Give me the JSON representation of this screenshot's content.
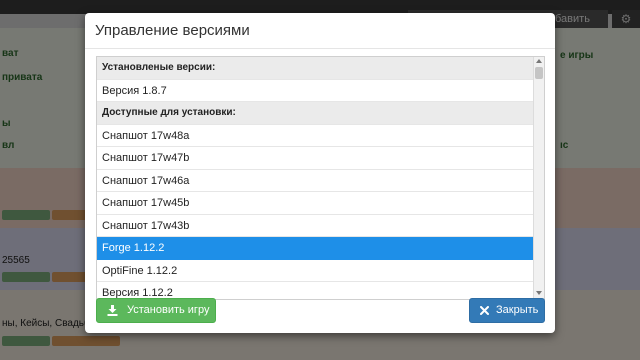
{
  "background": {
    "add_server_label": "бавить сервер",
    "gear_glyph": "⚙",
    "left_items": [
      "ват",
      "привата",
      "ы",
      "вл"
    ],
    "left_port": "25565",
    "left_tags": "ны, Кейсы, Свадьб",
    "right_items": [
      "е игры",
      "ıс"
    ]
  },
  "modal": {
    "title": "Управление версиями",
    "list": {
      "installed_header": "Установленые версии:",
      "installed": [
        "Версия 1.8.7"
      ],
      "available_header": "Доступные для установки:",
      "available": [
        "Снапшот 17w48a",
        "Снапшот 17w47b",
        "Снапшот 17w46a",
        "Снапшот 17w45b",
        "Снапшот 17w43b",
        "Forge 1.12.2",
        "OptiFine 1.12.2",
        "Версия 1.12.2"
      ],
      "selected": "Forge 1.12.2"
    },
    "install_button": "Установить игру",
    "close_button": "Закрыть",
    "colors": {
      "selection": "#1e8fe8",
      "install_button": "#5cb85c",
      "close_button": "#337ab7"
    }
  }
}
